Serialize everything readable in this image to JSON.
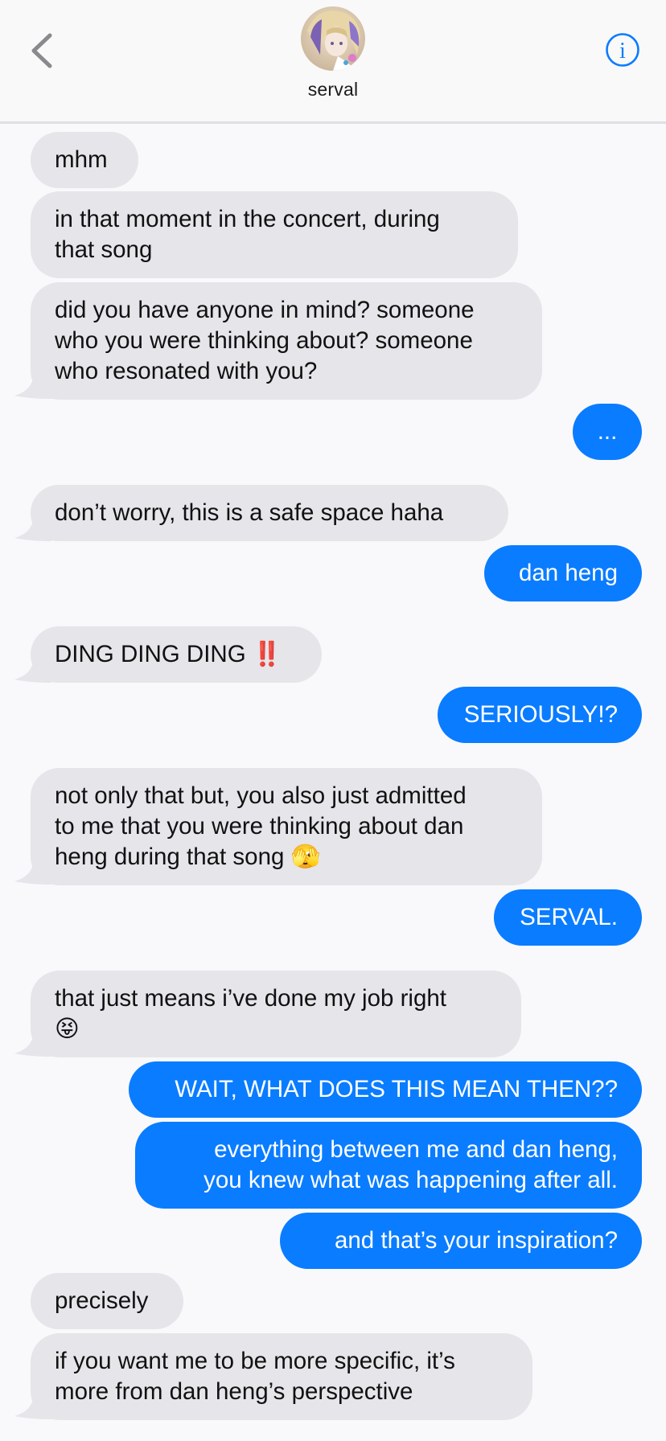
{
  "header": {
    "contact_name": "serval"
  },
  "messages": [
    {
      "from": "them",
      "lines": [
        "mhm"
      ]
    },
    {
      "from": "them",
      "lines": [
        "in that moment in the concert, during",
        "that song"
      ]
    },
    {
      "from": "them",
      "lines": [
        "did you have anyone in mind? someone",
        "who you were thinking about? someone",
        "who resonated with you?"
      ]
    },
    {
      "from": "me",
      "lines": [
        "..."
      ]
    },
    {
      "from": "them",
      "lines": [
        "don’t worry, this is a safe space haha"
      ]
    },
    {
      "from": "me",
      "lines": [
        "dan heng"
      ]
    },
    {
      "from": "them",
      "lines": [
        "DING DING DING ‼️"
      ]
    },
    {
      "from": "me",
      "lines": [
        "SERIOUSLY!?"
      ]
    },
    {
      "from": "them",
      "lines": [
        "not only that but, you also just admitted",
        "to me that you were thinking about dan",
        "heng during that song 🫣"
      ]
    },
    {
      "from": "me",
      "lines": [
        "SERVAL."
      ]
    },
    {
      "from": "them",
      "lines": [
        "that just means i’ve done my job right",
        "😝"
      ]
    },
    {
      "from": "me",
      "lines": [
        "WAIT, WHAT DOES THIS MEAN THEN??"
      ]
    },
    {
      "from": "me",
      "lines": [
        "everything between me and dan heng,",
        "you knew what was happening after all."
      ]
    },
    {
      "from": "me",
      "lines": [
        "and that’s your inspiration?"
      ]
    },
    {
      "from": "them",
      "lines": [
        "precisely"
      ]
    },
    {
      "from": "them",
      "lines": [
        "if you want me to be more specific, it’s",
        "more from dan heng’s perspective"
      ]
    }
  ],
  "colors": {
    "incoming_bubble": "#e5e5ea",
    "outgoing_bubble": "#0a7cff",
    "accent": "#0a7cff"
  },
  "icons": [
    "back-chevron-icon",
    "info-icon",
    "avatar"
  ]
}
